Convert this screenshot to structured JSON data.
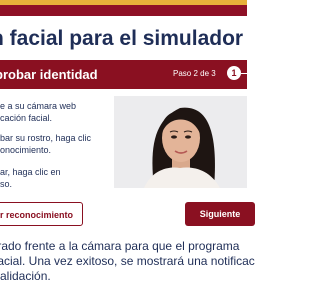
{
  "page": {
    "title": "n facial para el simulador"
  },
  "step_header": {
    "title": "probar identidad",
    "step_label": "Paso 2 de 3",
    "step_number": "1"
  },
  "instructions": [
    {
      "line1": "e a su cámara web",
      "line2": "cación facial."
    },
    {
      "line1": "bar su rostro, haga clic",
      "line2": "onocimiento."
    },
    {
      "line1": "ar, haga clic en",
      "line2": "so."
    }
  ],
  "buttons": {
    "retry_label": "r reconocimiento",
    "next_label": "Siguiente"
  },
  "footer": {
    "line1": "trado frente a la cámara para que el programa",
    "line2": "facial. Una vez exitoso, se mostrará una notificac",
    "line3": "validación."
  },
  "colors": {
    "brand_red": "#8a1021",
    "brand_gold": "#e7b13a",
    "text_navy": "#1f2e57"
  }
}
